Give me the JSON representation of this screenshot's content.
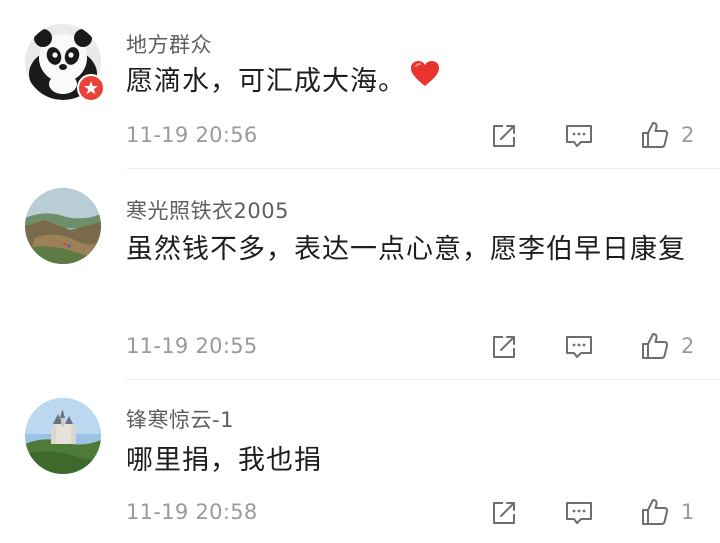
{
  "comments": [
    {
      "username": "地方群众",
      "text": "愿滴水，可汇成大海。",
      "emoji": "heart-emoji",
      "time": "11-19 20:56",
      "likes": "2",
      "avatar": "panda-avatar",
      "badge": "vip-badge"
    },
    {
      "username": "寒光照铁衣2005",
      "text": "虽然钱不多，表达一点心意，愿李伯早日康复",
      "time": "11-19 20:55",
      "likes": "2",
      "avatar": "landscape-avatar"
    },
    {
      "username": "锋寒惊云-1",
      "text": "哪里捐，我也捐",
      "time": "11-19 20:58",
      "likes": "1",
      "avatar": "castle-avatar"
    }
  ],
  "icons": {
    "share": "share-icon",
    "reply": "reply-icon",
    "like": "like-icon"
  },
  "colors": {
    "username": "#5f5f5f",
    "text": "#1e1e1e",
    "meta": "#9a9a9a",
    "heart": "#e8342c"
  }
}
